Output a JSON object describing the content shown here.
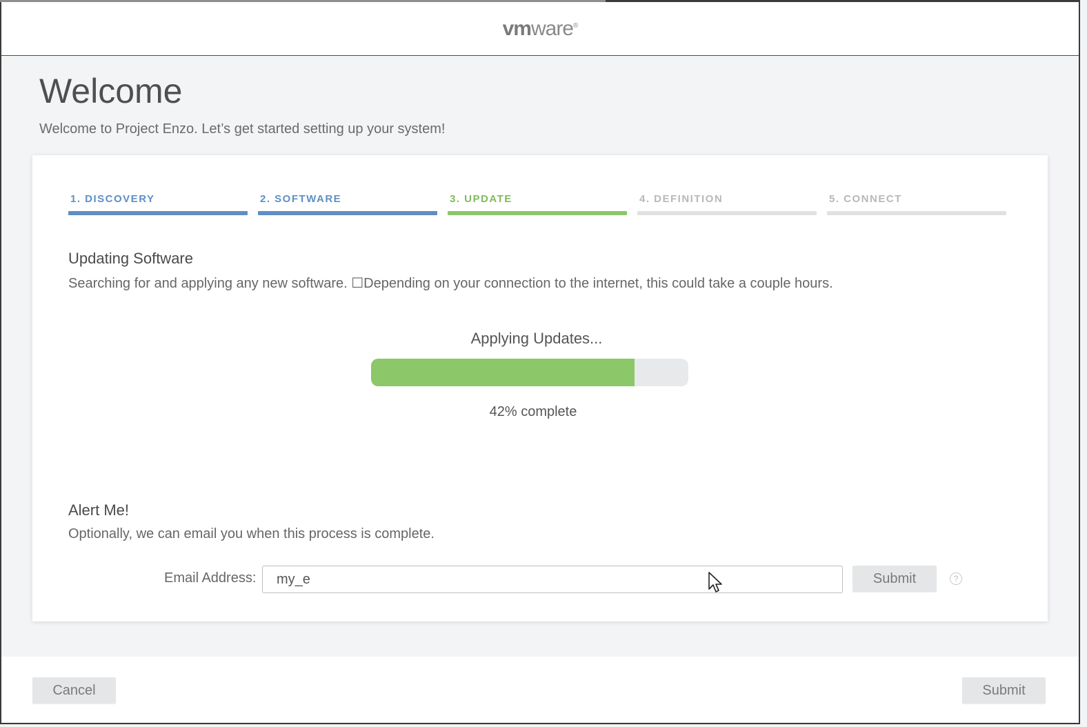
{
  "header": {
    "logo_vm": "vm",
    "logo_ware": "ware",
    "logo_reg": "®"
  },
  "page": {
    "title": "Welcome",
    "subtitle": "Welcome to Project Enzo. Let’s get started setting up your system!"
  },
  "wizard": {
    "steps": [
      {
        "label": "1. DISCOVERY",
        "state": "done",
        "color": "#5e8fc4",
        "bar_color": "#5e8fc4"
      },
      {
        "label": "2. SOFTWARE",
        "state": "done",
        "color": "#5e8fc4",
        "bar_color": "#5e8fc4"
      },
      {
        "label": "3. UPDATE",
        "state": "active",
        "color": "#7fbb5c",
        "bar_color": "#8cc76a"
      },
      {
        "label": "4. DEFINITION",
        "state": "pending",
        "color": "#b8b8b8",
        "bar_color": "#e0e1e2"
      },
      {
        "label": "5. CONNECT",
        "state": "pending",
        "color": "#b8b8b8",
        "bar_color": "#e0e1e2"
      }
    ]
  },
  "update": {
    "heading": "Updating Software",
    "description": "Searching for and applying any new software. ☐Depending on your connection to the internet, this could take a couple hours.",
    "progress_label": "Applying Updates...",
    "progress_percent": 42,
    "progress_fill_fraction": 0.83,
    "progress_text": "42% complete"
  },
  "alert": {
    "heading": "Alert Me!",
    "description": "Optionally, we can email you when this process is complete.",
    "email_label": "Email Address:",
    "email_value": "my_e",
    "submit_label": "Submit",
    "help_glyph": "?"
  },
  "footer": {
    "cancel_label": "Cancel",
    "submit_label": "Submit"
  }
}
